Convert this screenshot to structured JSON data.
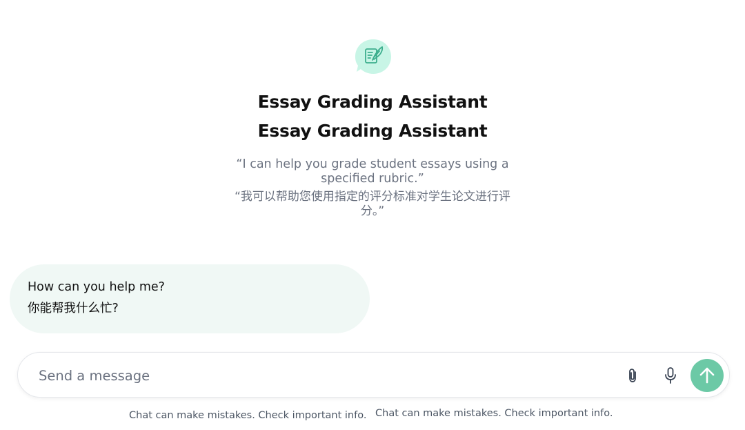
{
  "assistant": {
    "icon": "quill-document-icon",
    "accent_color": "#c8f5e6",
    "icon_color": "#3cae8d",
    "title_en": "Essay Grading Assistant",
    "title_dup": "Essay Grading Assistant",
    "description_en": "“I can help you grade student essays using a specified rubric.”",
    "description_zh": "“我可以帮助您使用指定的评分标准对学生论文进行评分。”"
  },
  "suggestion": {
    "line_en": "How can you help me?",
    "line_zh": "你能帮我什么忙?"
  },
  "composer": {
    "placeholder": "Send a message",
    "attach_icon": "paperclip-icon",
    "mic_icon": "microphone-icon",
    "send_icon": "arrow-up-icon",
    "send_color": "#6cc9a6"
  },
  "footer": {
    "disclaimer_1": "Chat can make mistakes. Check important info.",
    "disclaimer_2": "Chat can make mistakes. Check important info."
  }
}
